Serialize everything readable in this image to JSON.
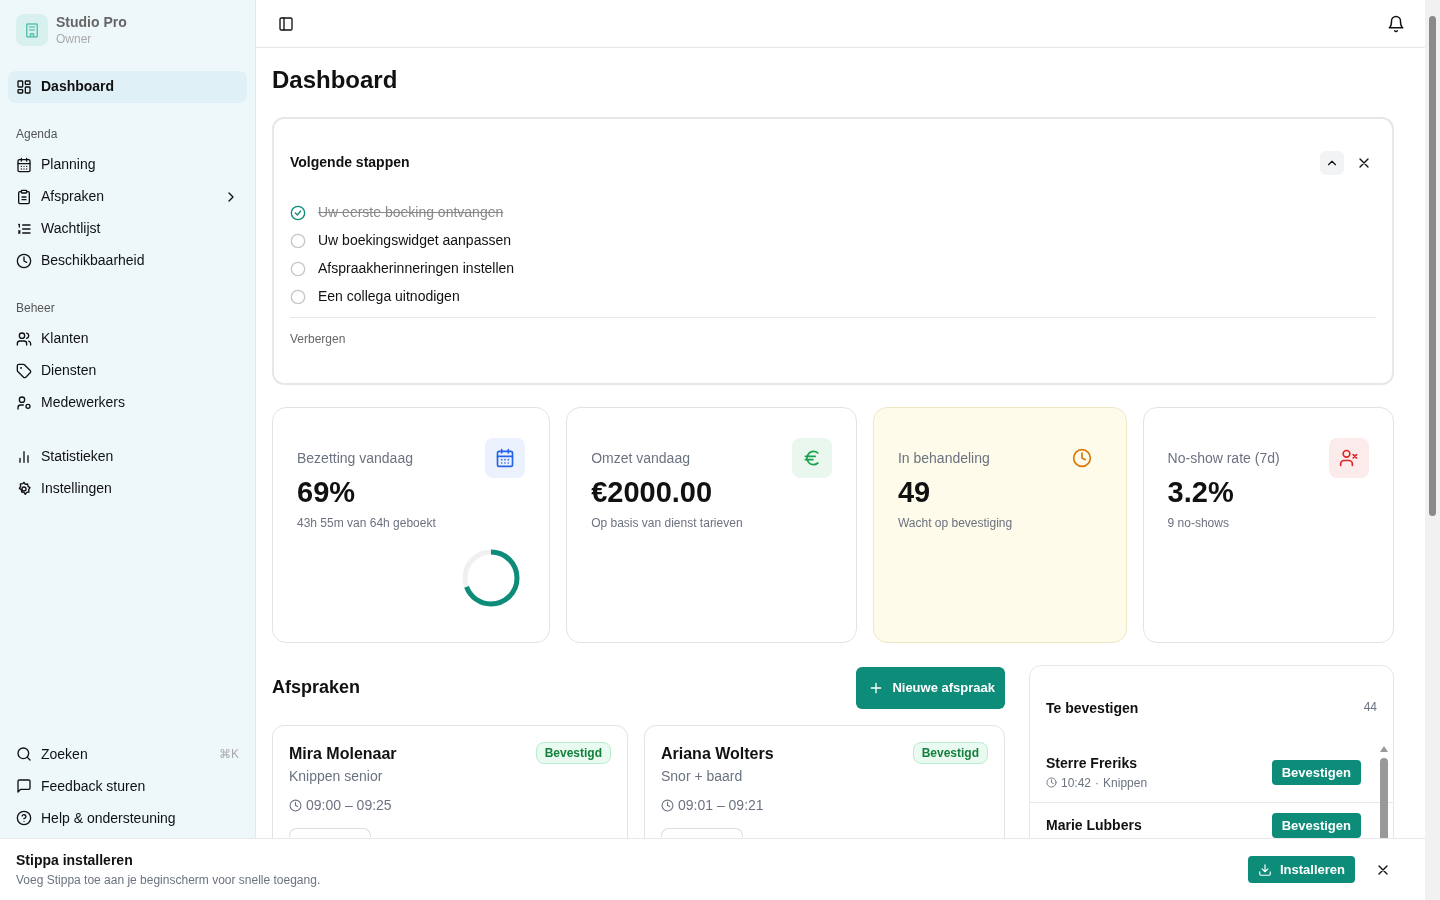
{
  "sidebar": {
    "brand": {
      "name": "Studio Pro",
      "role": "Owner"
    },
    "top": [
      {
        "label": "Dashboard",
        "selected": true
      }
    ],
    "sections": [
      {
        "title": "Agenda",
        "items": [
          {
            "label": "Planning",
            "selected": false,
            "has_submenu": false
          },
          {
            "label": "Afspraken",
            "selected": false,
            "has_submenu": true
          },
          {
            "label": "Wachtlijst",
            "selected": false,
            "has_submenu": false
          },
          {
            "label": "Beschikbaarheid",
            "selected": false,
            "has_submenu": false
          }
        ]
      },
      {
        "title": "Beheer",
        "items": [
          {
            "label": "Klanten",
            "selected": false,
            "has_submenu": false
          },
          {
            "label": "Diensten",
            "selected": false,
            "has_submenu": false
          },
          {
            "label": "Medewerkers",
            "selected": false,
            "has_submenu": false
          }
        ]
      },
      {
        "items": [
          {
            "label": "Statistieken",
            "selected": false,
            "has_submenu": false
          },
          {
            "label": "Instellingen",
            "selected": false,
            "has_submenu": false
          }
        ]
      }
    ],
    "bottom": [
      {
        "label": "Zoeken",
        "shortcut": "⌘K"
      },
      {
        "label": "Feedback sturen"
      },
      {
        "label": "Help & ondersteuning"
      }
    ]
  },
  "page": {
    "title": "Dashboard"
  },
  "steps": {
    "title": "Volgende stappen",
    "items": [
      {
        "label": "Uw eerste boeking ontvangen",
        "done": true
      },
      {
        "label": "Uw boekingswidget aanpassen",
        "done": false
      },
      {
        "label": "Afspraakherinneringen instellen",
        "done": false
      },
      {
        "label": "Een collega uitnodigen",
        "done": false
      }
    ],
    "hide": "Verbergen"
  },
  "stats": [
    {
      "label": "Bezetting vandaag",
      "value": "69%",
      "note": "43h 55m van 64h geboekt",
      "color": "#2563eb",
      "highlighted": false,
      "level": 0.69
    },
    {
      "label": "Omzet vandaag",
      "value": "€2000.00",
      "note": "Op basis van dienst tarieven",
      "color": "#16a34a",
      "highlighted": false
    },
    {
      "label": "In behandeling",
      "value": "49",
      "note": "Wacht op bevestiging",
      "color": "#d97706",
      "highlighted": true
    },
    {
      "label": "No-show rate (7d)",
      "value": "3.2%",
      "note": "9 no-shows",
      "color": "#dc2626",
      "highlighted": false
    }
  ],
  "appointments": {
    "title": "Afspraken",
    "new_button": "Nieuwe afspraak",
    "items": [
      {
        "name": "Mira Molenaar",
        "service": "Knippen senior",
        "time": "09:00 – 09:25",
        "status": "Bevestigd"
      },
      {
        "name": "Ariana Wolters",
        "service": "Snor + baard",
        "time": "09:01 – 09:21",
        "status": "Bevestigd"
      }
    ]
  },
  "pending": {
    "title": "Te bevestigen",
    "count": "44",
    "items": [
      {
        "name": "Sterre Freriks",
        "time": "10:42",
        "separator": "·",
        "service": "Knippen",
        "action": "Bevestigen"
      },
      {
        "name": "Marie Lubbers",
        "action": "Bevestigen"
      }
    ]
  },
  "install_banner": {
    "title": "Stippa installeren",
    "text": "Voeg Stippa toe aan je beginscherm voor snelle toegang.",
    "button": "Installeren"
  }
}
